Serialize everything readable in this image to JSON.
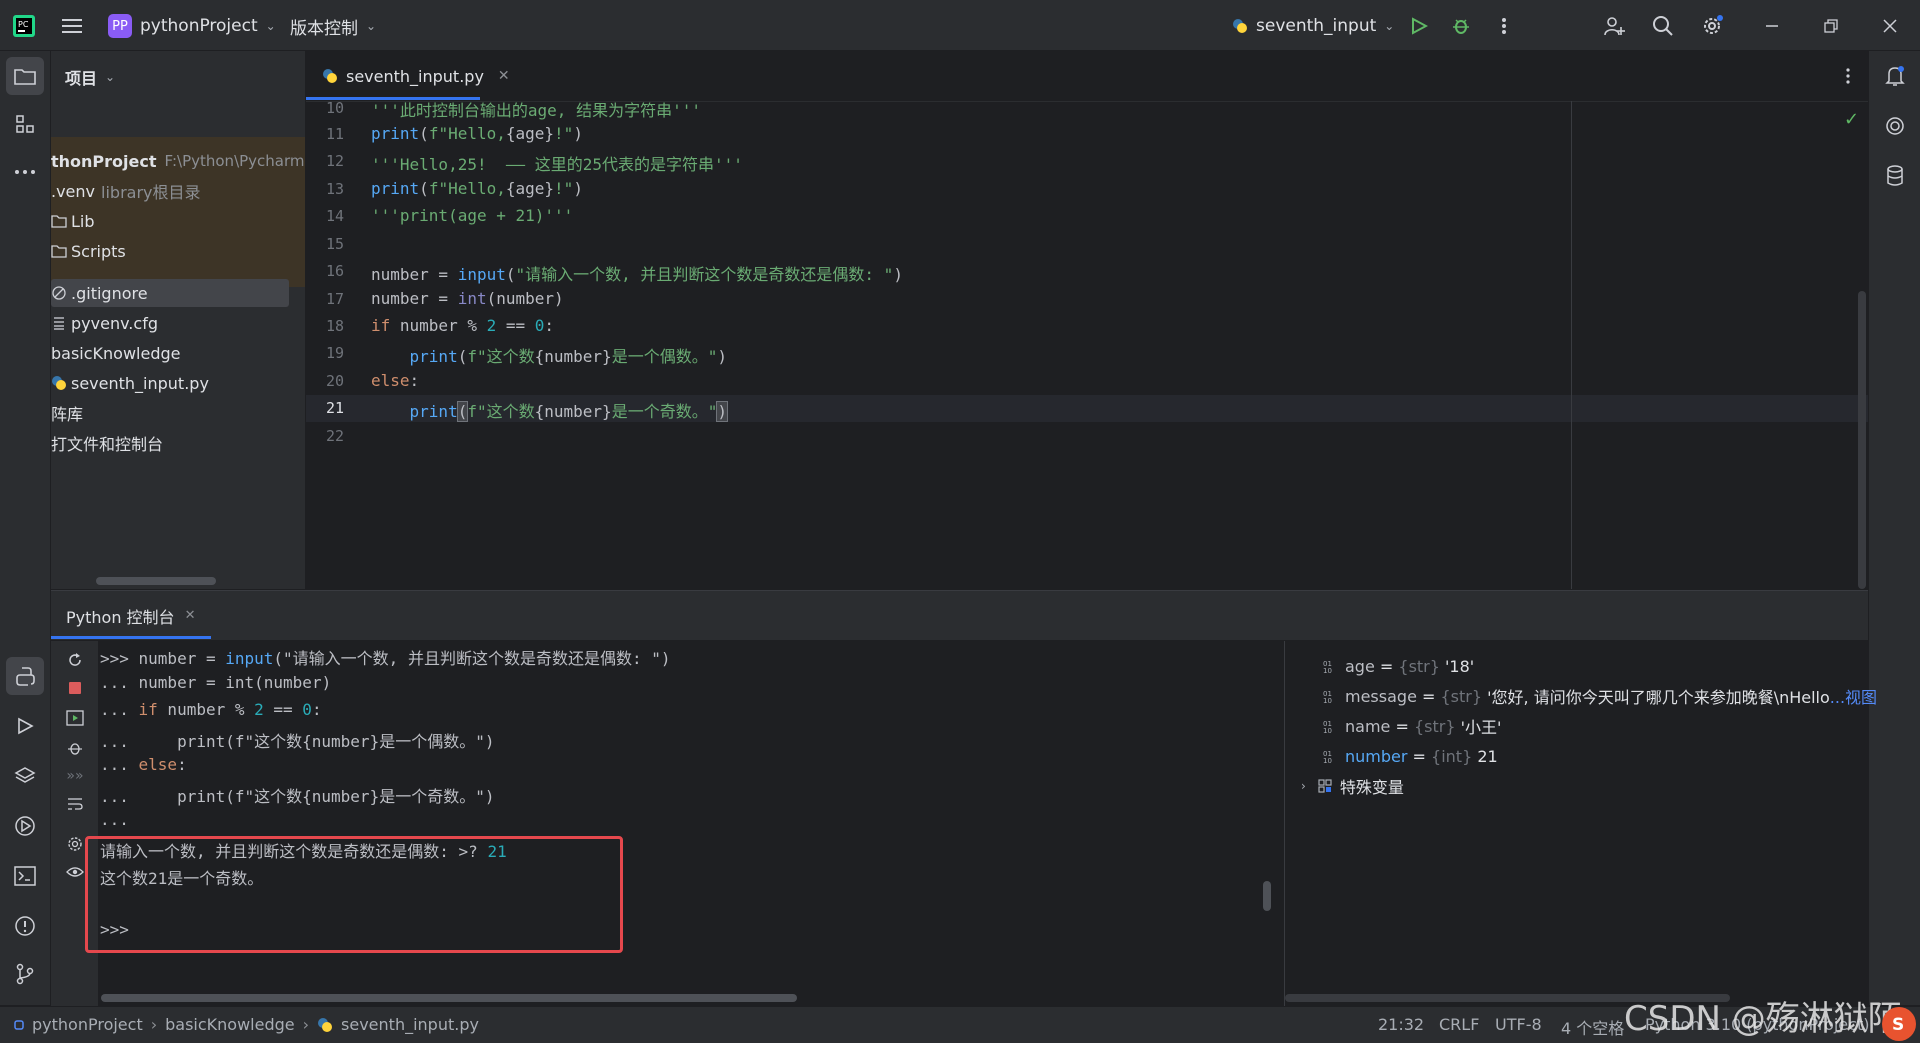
{
  "titlebar": {
    "project_badge": "PP",
    "project_name": "pythonProject",
    "vcs_menu": "版本控制",
    "run_config": "seventh_input"
  },
  "project_panel": {
    "header": "项目",
    "root_name": "thonProject",
    "root_path": "F:\\Python\\PycharmP",
    "venv": ".venv",
    "venv_hint": "library根目录",
    "items": [
      ".Lib",
      "Scripts",
      ".gitignore",
      "pyvenv.cfg",
      "basicKnowledge",
      "seventh_input.py",
      "阵库",
      "打文件和控制台"
    ],
    "lib": "Lib"
  },
  "editor": {
    "tab_label": "seventh_input.py",
    "line_numbers": [
      "10",
      "11",
      "12",
      "13",
      "14",
      "15",
      "16",
      "17",
      "18",
      "19",
      "20",
      "21",
      "22"
    ],
    "current_line": "21"
  },
  "code": {
    "l10": "'''此时控制台输出的age, 结果为字符串'''",
    "l11_fn": "print",
    "l11_a": "(",
    "l11_s": "f\"Hello,",
    "l11_t": "{age}",
    "l11_e": "!\"",
    "l11_c": ")",
    "l12": "'''Hello,25!  —— 这里的25代表的是字符串'''",
    "l13_fn": "print",
    "l13_a": "(",
    "l13_s": "f\"Hello,",
    "l13_t": "{age}",
    "l13_e": "!\"",
    "l13_c": ")",
    "l14": "'''print(age + 21)'''",
    "l16_a": "number = ",
    "l16_fn": "input",
    "l16_b": "(",
    "l16_s": "\"请输入一个数, 并且判断这个数是奇数还是偶数: \"",
    "l16_c": ")",
    "l17_a": "number = ",
    "l17_fn": "int",
    "l17_b": "(number)",
    "l18_kw": "if",
    "l18_a": " number % ",
    "l18_n1": "2",
    "l18_b": " == ",
    "l18_n2": "0",
    "l18_c": ":",
    "l19_fn": "print",
    "l19_a": "(",
    "l19_s": "f\"这个数",
    "l19_t": "{number}",
    "l19_e": "是一个偶数。\"",
    "l19_c": ")",
    "l20_kw": "else",
    "l20_c": ":",
    "l21_fn": "print",
    "l21_a": "(",
    "l21_s": "f\"这个数",
    "l21_t": "{number}",
    "l21_e": "是一个奇数。\"",
    "l21_c": ")"
  },
  "console": {
    "tab_label": "Python 控制台",
    "c1_a": ">>> number = ",
    "c1_fn": "input",
    "c1_s": "(\"请输入一个数, 并且判断这个数是奇数还是偶数: \")",
    "c2_a": "... number = ",
    "c2_fn": "int",
    "c2_b": "(number)",
    "c3_a": "... ",
    "c3_kw": "if",
    "c3_b": " number % ",
    "c3_n1": "2",
    "c3_c": " == ",
    "c3_n2": "0",
    "c3_d": ":",
    "c4_a": "...     ",
    "c4_fn": "print",
    "c4_s": "(f\"这个数{number}是一个偶数。\")",
    "c5_a": "... ",
    "c5_kw": "else",
    "c5_c": ":",
    "c6_a": "...     ",
    "c6_fn": "print",
    "c6_s": "(f\"这个数{number}是一个奇数。\")",
    "c7": "...",
    "c8_a": "请输入一个数, 并且判断这个数是奇数还是偶数: >? ",
    "c8_input": "21",
    "c9": "这个数21是一个奇数。",
    "c10": ">>>",
    "highlight_color": "#e5484d"
  },
  "variables": {
    "rows": [
      {
        "name": "age",
        "eq": " = ",
        "type": "{str}",
        "value": " '18'"
      },
      {
        "name": "message",
        "eq": " = ",
        "type": "{str}",
        "value": " '您好, 请问你今天叫了哪几个来参加晚餐\\nHello",
        "link": "...视图"
      },
      {
        "name": "name",
        "eq": " = ",
        "type": "{str}",
        "value": " '小王'"
      },
      {
        "name": "number",
        "eq": " = ",
        "type": "{int}",
        "value": " 21"
      }
    ],
    "special": "特殊变量"
  },
  "statusbar": {
    "crumb1": "pythonProject",
    "crumb2": "basicKnowledge",
    "crumb3": "seventh_input.py",
    "position": "21:32",
    "line_sep": "CRLF",
    "encoding": "UTF-8",
    "indent": "4 个空格",
    "interpreter": "Python 3.10 (pythonProject)",
    "watermark": "CSDN @殇淋狱陌"
  },
  "colors": {
    "accent": "#3574f0",
    "keyword": "#cf8e6d",
    "string": "#6aab73",
    "function": "#56a8f5",
    "number": "#2aacb8"
  }
}
